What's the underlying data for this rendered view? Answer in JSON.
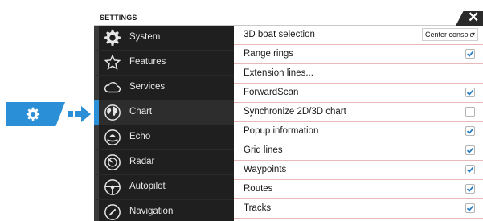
{
  "window": {
    "title": "SETTINGS",
    "close_icon": "close-icon"
  },
  "sidebar": {
    "items": [
      {
        "label": "System",
        "icon": "gear-icon",
        "active": false
      },
      {
        "label": "Features",
        "icon": "star-icon",
        "active": false
      },
      {
        "label": "Services",
        "icon": "cloud-icon",
        "active": false
      },
      {
        "label": "Chart",
        "icon": "chart-globe-icon",
        "active": true
      },
      {
        "label": "Echo",
        "icon": "echo-icon",
        "active": false
      },
      {
        "label": "Radar",
        "icon": "radar-icon",
        "active": false
      },
      {
        "label": "Autopilot",
        "icon": "steering-wheel-icon",
        "active": false
      },
      {
        "label": "Navigation",
        "icon": "navigation-compass-icon",
        "active": false
      }
    ]
  },
  "settings": {
    "rows": [
      {
        "label": "3D boat selection",
        "control": "dropdown",
        "value": "Center console"
      },
      {
        "label": "Range rings",
        "control": "checkbox",
        "checked": true
      },
      {
        "label": "Extension lines...",
        "control": "none"
      },
      {
        "label": "ForwardScan",
        "control": "checkbox",
        "checked": true
      },
      {
        "label": "Synchronize 2D/3D chart",
        "control": "checkbox",
        "checked": false
      },
      {
        "label": "Popup information",
        "control": "checkbox",
        "checked": true
      },
      {
        "label": "Grid lines",
        "control": "checkbox",
        "checked": true
      },
      {
        "label": "Waypoints",
        "control": "checkbox",
        "checked": true
      },
      {
        "label": "Routes",
        "control": "checkbox",
        "checked": true
      },
      {
        "label": "Tracks",
        "control": "checkbox",
        "checked": true
      }
    ]
  },
  "callout": {
    "icon": "gear-icon",
    "arrow_icon": "arrow-right-icon"
  },
  "colors": {
    "accent": "#2a8fd6",
    "sidebar_bg": "#1f1f1f",
    "row_divider": "#e8b8b8",
    "check": "#2a7fc4"
  }
}
